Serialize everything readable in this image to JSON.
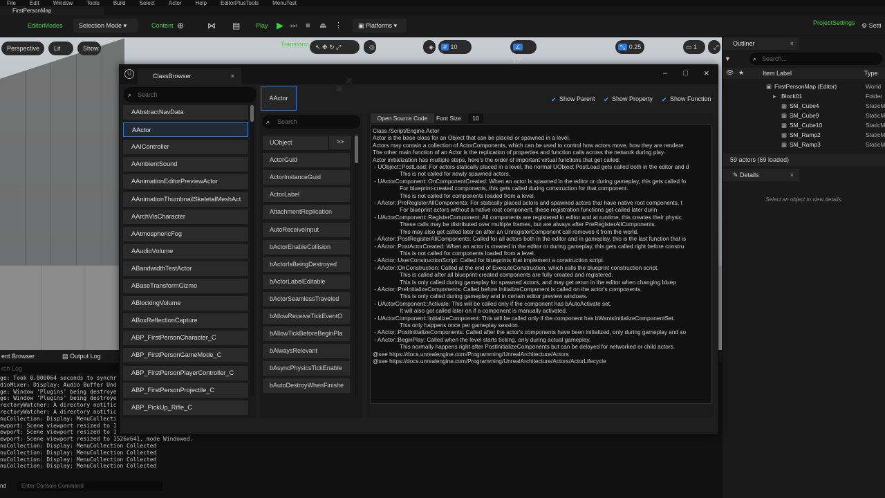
{
  "menubar": [
    "File",
    "Edit",
    "Window",
    "Tools",
    "Build",
    "Select",
    "Actor",
    "Help",
    "EditorPlusTools",
    "MenuTest"
  ],
  "map_tab": "FirstPersonMap",
  "toolbar": {
    "editor_modes": "EditorModes",
    "selection_mode": "Selection Mode",
    "content": "Content",
    "play": "Play",
    "platforms": "Platforms",
    "project_settings": "ProjectSettings",
    "settings": "Setti"
  },
  "viewport": {
    "perspective": "Perspective",
    "lit": "Lit",
    "show": "Show",
    "transform_label": "Transform",
    "snap_angle": "10°",
    "snap_scale": "0.25",
    "camera_speed": "1"
  },
  "bottom": {
    "tab_content": "ent Browser",
    "tab_log": "Output Log",
    "search_placeholder": "rch Log",
    "log_lines": [
      "ge: Took 0.000064 seconds to synchr",
      "dioMixer: Display: Audio Buffer Und",
      "ge: Window 'Plugins' being destroye",
      "ge: Window 'Plugins' being destroye",
      "rectoryWatcher: A directory notific",
      "rectoryWatcher: A directory notific",
      "nuCollection: Display: MenuCollecti",
      "ewport: Scene viewport resized to 1",
      "ewport: Scene viewport resized to 1",
      "ewport: Scene viewport resized to 1526x641, mode Windowed.",
      "nuCollection: Display: MenuCollection Collected",
      "nuCollection: Display: MenuCollection Collected",
      "nuCollection: Display: MenuCollection Collected",
      "nuCollection: Display: MenuCollection Collected"
    ],
    "cmd_label": "nd",
    "console_placeholder": "Enter Console Command"
  },
  "outliner": {
    "tab": "Outliner",
    "search_placeholder": "Search...",
    "col_label": "Item Label",
    "col_type": "Type",
    "rows": [
      {
        "label": "FirstPersonMap (Editor)",
        "type": "World"
      },
      {
        "label": "Block01",
        "type": "Folder"
      },
      {
        "label": "SM_Cube4",
        "type": "StaticM"
      },
      {
        "label": "SM_Cube9",
        "type": "StaticM"
      },
      {
        "label": "SM_Cube10",
        "type": "StaticM"
      },
      {
        "label": "SM_Ramp2",
        "type": "StaticM"
      },
      {
        "label": "SM_Ramp3",
        "type": "StaticM"
      }
    ],
    "count": "59 actors (69 loaded)"
  },
  "details": {
    "tab": "Details",
    "empty": "Select an object to view details."
  },
  "class_browser": {
    "title": "ClassBrowser",
    "search_placeholder": "Search",
    "classes": [
      "AAbstractNavData",
      "AActor",
      "AAIController",
      "AAmbientSound",
      "AAnimationEditorPreviewActor",
      "AAnimationThumbnailSkeletalMeshAct",
      "AArchVisCharacter",
      "AAtmosphericFog",
      "AAudioVolume",
      "ABandwidthTestActor",
      "ABaseTransformGizmo",
      "ABlockingVolume",
      "ABoxReflectionCapture",
      "ABP_FirstPersonCharacter_C",
      "ABP_FirstPersonGameMode_C",
      "ABP_FirstPersonPlayerController_C",
      "ABP_FirstPersonProjectile_C",
      "ABP_PickUp_Rifle_C"
    ],
    "selected_class": "AActor",
    "member_search_placeholder": "Search",
    "expand_btn": ">>",
    "members": [
      "UObject",
      "ActorGuid",
      "ActorInstanceGuid",
      "ActorLabel",
      "AttachmentReplication",
      "AutoReceiveInput",
      "bActorEnableCollision",
      "bActorIsBeingDestroyed",
      "bActorLabelEditable",
      "bActorSeamlessTraveled",
      "bAllowReceiveTickEventO",
      "bAllowTickBeforeBeginPla",
      "bAlwaysRelevant",
      "bAsyncPhysicsTickEnable",
      "bAutoDestroyWhenFinishe"
    ],
    "show_parent": "Show Parent",
    "show_property": "Show Property",
    "show_function": "Show Function",
    "open_source": "Open Source Code",
    "font_size_label": "Font Size",
    "font_size_value": "10",
    "doc_lines": [
      "Class /Script/Engine.Actor",
      "",
      "Actor is the base class for an Object that can be placed or spawned in a level.",
      "Actors may contain a collection of ActorComponents, which can be used to control how actors move, how they are rendere",
      "The other main function of an Actor is the replication of properties and function calls across the network during play.",
      "",
      "",
      "Actor initialization has multiple steps, here's the order of important virtual functions that get called:",
      " - UObject::PostLoad: For actors statically placed in a level, the normal UObject PostLoad gets called both in the editor and d",
      "                 This is not called for newly spawned actors.",
      " - UActorComponent::OnComponentCreated: When an actor is spawned in the editor or during gameplay, this gets called fo",
      "                 For blueprint-created components, this gets called during construction for that component.",
      "                 This is not called for components loaded from a level.",
      " - AActor::PreRegisterAllComponents: For statically placed actors and spawned actors that have native root components, t",
      "                 For blueprint actors without a native root component, these registration functions get called later durin",
      " - UActorComponent::RegisterComponent: All components are registered in editor and at runtime, this creates their physic",
      "                 These calls may be distributed over multiple frames, but are always after PreRegisterAllComponents.",
      "                 This may also get called later on after an UnregisterComponent call removes it from the world.",
      " - AActor::PostRegisterAllComponents: Called for all actors both in the editor and in gameplay, this is the last function that is",
      " - AActor::PostActorCreated: When an actor is created in the editor or during gameplay, this gets called right before constru",
      "                 This is not called for components loaded from a level.",
      " - AActor::UserConstructionScript: Called for blueprints that implement a construction script.",
      " - AActor::OnConstruction: Called at the end of ExecuteConstruction, which calls the blueprint construction script.",
      "                 This is called after all blueprint-created components are fully created and registered.",
      "                 This is only called during gameplay for spawned actors, and may get rerun in the editor when changing bluep",
      " - AActor::PreInitializeComponents: Called before InitializeComponent is called on the actor's components.",
      "                 This is only called during gameplay and in certain editor preview windows.",
      " - UActorComponent::Activate: This will be called only if the component has bAutoActivate set.",
      "                 It will also got called later on if a component is manually activated.",
      " - UActorComponent::InitializeComponent: This will be called only if the component has bWantsInitializeComponentSet.",
      "                 This only happens once per gameplay session.",
      " - AActor::PostInitializeComponents: Called after the actor's components have been initialized, only during gameplay and so",
      " - AActor::BeginPlay: Called when the level starts ticking, only during actual gameplay.",
      "                 This normally happens right after PostInitializeComponents but can be delayed for networked or child actors.",
      "",
      "@see https://docs.unrealengine.com/Programming/UnrealArchitecture/Actors",
      "@see https://docs.unrealengine.com/Programming/UnrealArchitecture/Actors/ActorLifecycle"
    ]
  },
  "colors": {
    "accent": "#2f7ad8",
    "green": "#3fcf3f",
    "panel": "#1a1a1a"
  }
}
